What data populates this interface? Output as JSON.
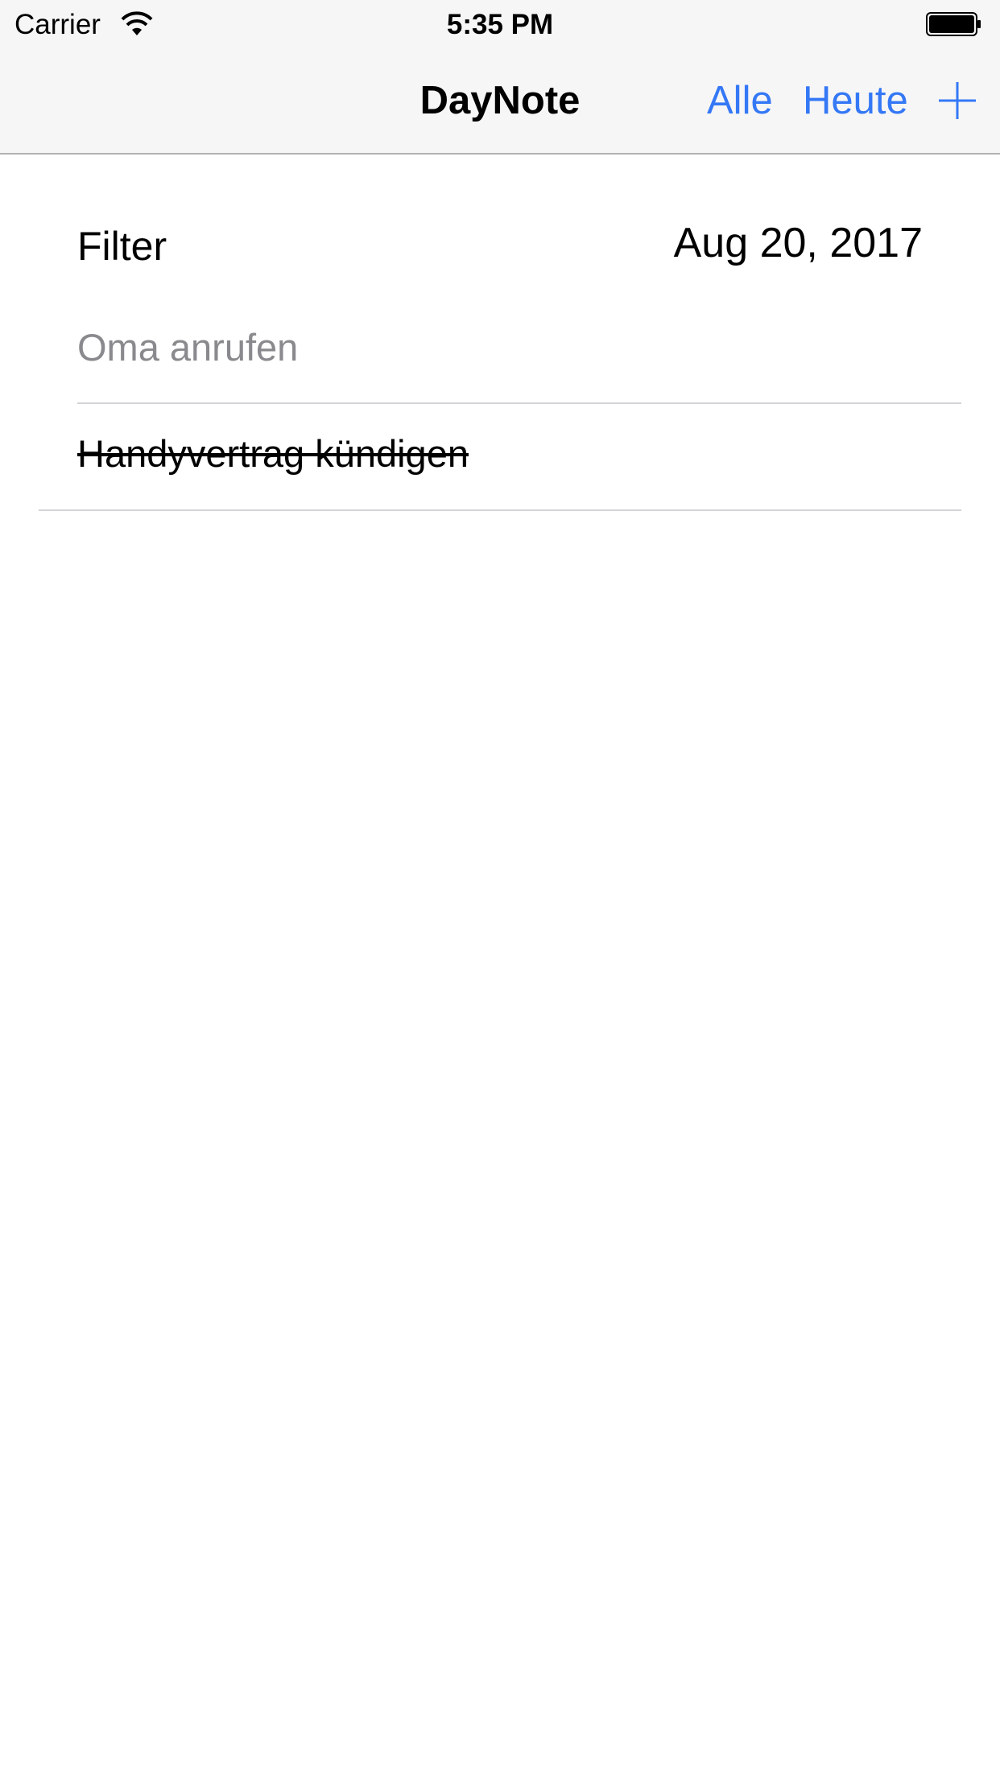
{
  "status_bar": {
    "carrier": "Carrier",
    "time": "5:35 PM",
    "wifi_icon": "wifi-icon",
    "battery_icon": "battery-icon"
  },
  "nav": {
    "title": "DayNote",
    "all_label": "Alle",
    "today_label": "Heute",
    "add_icon": "plus-icon",
    "accent_color": "#3478f6"
  },
  "filter": {
    "label": "Filter",
    "date": "Aug 20, 2017"
  },
  "tasks": [
    {
      "text": "Oma anrufen",
      "done": false
    },
    {
      "text": "Handyvertrag kündigen",
      "done": true
    }
  ]
}
